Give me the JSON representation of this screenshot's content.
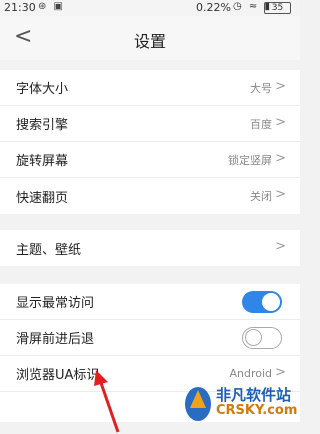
{
  "status_bar": {
    "time": "21:30",
    "left_icons": "⊛ ▣",
    "speed": "0.22%",
    "right_icons": "◷ ≈ ▮",
    "battery": "35"
  },
  "header": {
    "back_icon": "<",
    "title": "设置"
  },
  "groups": [
    {
      "rows": [
        {
          "label": "字体大小",
          "value": "大号"
        },
        {
          "label": "搜索引擎",
          "value": "百度"
        },
        {
          "label": "旋转屏幕",
          "value": "锁定竖屏"
        },
        {
          "label": "快速翻页",
          "value": "关闭"
        }
      ]
    },
    {
      "rows": [
        {
          "label": "主题、壁纸",
          "value": ""
        }
      ]
    },
    {
      "rows": [
        {
          "label": "显示最常访问",
          "toggle": true
        },
        {
          "label": "滑屏前进后退",
          "toggle": false
        },
        {
          "label": "浏览器UA标识",
          "value": "Android"
        }
      ]
    }
  ],
  "chevron": ">",
  "watermark": {
    "title": "非凡软件站",
    "sub": "CRSKY.com"
  },
  "colors": {
    "toggle_on": "#2f86e6",
    "arrow": "#e02020"
  }
}
